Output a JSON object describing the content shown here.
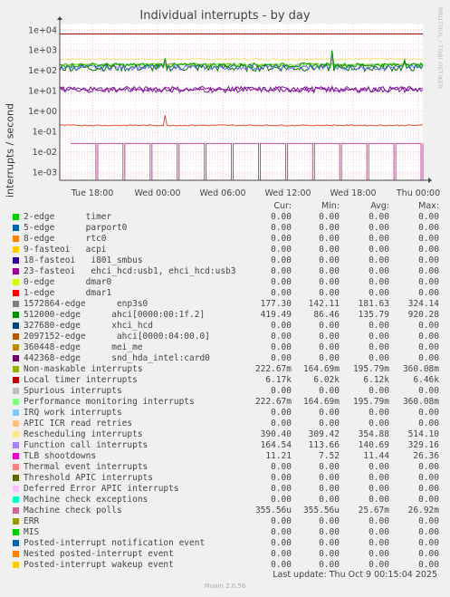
{
  "chart_data": {
    "type": "line",
    "title": "Individual interrupts - by day",
    "ylabel": "interrupts / second",
    "yscale": "log",
    "ylim": [
      0.0004,
      20000
    ],
    "yticks": [
      "1e-03",
      "1e-02",
      "1e-01",
      "1e+00",
      "1e+01",
      "1e+02",
      "1e+03",
      "1e+04"
    ],
    "xticks": [
      "Tue 18:00",
      "Wed 00:00",
      "Wed 06:00",
      "Wed 12:00",
      "Wed 18:00",
      "Thu 00:00"
    ],
    "watermark": "RRDTOOL / TOBI OETIKER",
    "series_visible": [
      {
        "name": "Local timer interrupts",
        "color": "#990000",
        "level": 6170
      },
      {
        "name": "Non-maskable interrupts",
        "color": "#8fa000",
        "level": 195.79
      },
      {
        "name": "Performance monitoring interrupts",
        "color": "#98e878",
        "level": 195.79
      },
      {
        "name": "Machine check polls",
        "color": "#c24a9b",
        "level": 0.0257
      },
      {
        "name": "1572864-edge enp3s0",
        "color": "#00a000",
        "level": 181.63
      },
      {
        "name": "512000-edge ahci[0000:00:1f.2]",
        "color": "#007000",
        "level": 135.79
      },
      {
        "name": "23-fasteoi ehci_hcd:usb1, ehci_hcd:usb3",
        "color": "#990099",
        "level": 12.1
      },
      {
        "name": "Rescheduling interrupts",
        "color": "#f8e070",
        "level": 354.88
      },
      {
        "name": "Function call interrupts",
        "color": "#6a6aff",
        "level": 140.69
      },
      {
        "name": "TLB shootdowns",
        "color": "#6f249f",
        "level": 11.44
      },
      {
        "name": "Thermal event interrupts",
        "color": "#e05030",
        "level": 0.2
      }
    ]
  },
  "legend": {
    "headers": {
      "cur": "Cur:",
      "min": "Min:",
      "avg": "Avg:",
      "max": "Max:"
    },
    "rows": [
      {
        "name": "2-edge      timer",
        "color": "#00cc00",
        "cur": "0.00",
        "min": "0.00",
        "avg": "0.00",
        "max": "0.00"
      },
      {
        "name": "5-edge      parport0",
        "color": "#0066b3",
        "cur": "0.00",
        "min": "0.00",
        "avg": "0.00",
        "max": "0.00"
      },
      {
        "name": "8-edge      rtc0",
        "color": "#ff8000",
        "cur": "0.00",
        "min": "0.00",
        "avg": "0.00",
        "max": "0.00"
      },
      {
        "name": "9-fasteoi   acpi",
        "color": "#ffcc00",
        "cur": "0.00",
        "min": "0.00",
        "avg": "0.00",
        "max": "0.00"
      },
      {
        "name": "18-fasteoi   i801_smbus",
        "color": "#330099",
        "cur": "0.00",
        "min": "0.00",
        "avg": "0.00",
        "max": "0.00"
      },
      {
        "name": "23-fasteoi   ehci_hcd:usb1, ehci_hcd:usb3",
        "color": "#990099",
        "cur": "0.00",
        "min": "0.00",
        "avg": "0.00",
        "max": "0.00"
      },
      {
        "name": "0-edge      dmar0",
        "color": "#ccff00",
        "cur": "0.00",
        "min": "0.00",
        "avg": "0.00",
        "max": "0.00"
      },
      {
        "name": "1-edge      dmar1",
        "color": "#ff0000",
        "cur": "0.00",
        "min": "0.00",
        "avg": "0.00",
        "max": "0.00"
      },
      {
        "name": "1572864-edge      enp3s0",
        "color": "#808080",
        "cur": "177.30",
        "min": "142.11",
        "avg": "181.63",
        "max": "324.14"
      },
      {
        "name": "512000-edge      ahci[0000:00:1f.2]",
        "color": "#008f00",
        "cur": "419.49",
        "min": "86.46",
        "avg": "135.79",
        "max": "920.28"
      },
      {
        "name": "327680-edge      xhci_hcd",
        "color": "#00487d",
        "cur": "0.00",
        "min": "0.00",
        "avg": "0.00",
        "max": "0.00"
      },
      {
        "name": "2097152-edge      ahci[0000:04:00.0]",
        "color": "#b35a00",
        "cur": "0.00",
        "min": "0.00",
        "avg": "0.00",
        "max": "0.00"
      },
      {
        "name": "360448-edge      mei_me",
        "color": "#b38f00",
        "cur": "0.00",
        "min": "0.00",
        "avg": "0.00",
        "max": "0.00"
      },
      {
        "name": "442368-edge      snd_hda_intel:card0",
        "color": "#6b006b",
        "cur": "0.00",
        "min": "0.00",
        "avg": "0.00",
        "max": "0.00"
      },
      {
        "name": "Non-maskable interrupts",
        "color": "#8fb300",
        "cur": "222.67m",
        "min": "164.69m",
        "avg": "195.79m",
        "max": "360.08m"
      },
      {
        "name": "Local timer interrupts",
        "color": "#b30000",
        "cur": "6.17k",
        "min": "6.02k",
        "avg": "6.12k",
        "max": "6.46k"
      },
      {
        "name": "Spurious interrupts",
        "color": "#bebebe",
        "cur": "0.00",
        "min": "0.00",
        "avg": "0.00",
        "max": "0.00"
      },
      {
        "name": "Performance monitoring interrupts",
        "color": "#80ff80",
        "cur": "222.67m",
        "min": "164.69m",
        "avg": "195.79m",
        "max": "360.08m"
      },
      {
        "name": "IRQ work interrupts",
        "color": "#80c9ff",
        "cur": "0.00",
        "min": "0.00",
        "avg": "0.00",
        "max": "0.00"
      },
      {
        "name": "APIC ICR read retries",
        "color": "#ffc080",
        "cur": "0.00",
        "min": "0.00",
        "avg": "0.00",
        "max": "0.00"
      },
      {
        "name": "Rescheduling interrupts",
        "color": "#ffe680",
        "cur": "390.40",
        "min": "309.42",
        "avg": "354.88",
        "max": "514.10"
      },
      {
        "name": "Function call interrupts",
        "color": "#aa80ff",
        "cur": "164.54",
        "min": "113.66",
        "avg": "140.69",
        "max": "329.16"
      },
      {
        "name": "TLB shootdowns",
        "color": "#ee00cc",
        "cur": "11.21",
        "min": "7.52",
        "avg": "11.44",
        "max": "26.36"
      },
      {
        "name": "Thermal event interrupts",
        "color": "#ff8080",
        "cur": "0.00",
        "min": "0.00",
        "avg": "0.00",
        "max": "0.00"
      },
      {
        "name": "Threshold APIC interrupts",
        "color": "#666600",
        "cur": "0.00",
        "min": "0.00",
        "avg": "0.00",
        "max": "0.00"
      },
      {
        "name": "Deferred Error APIC interrupts",
        "color": "#ffbfff",
        "cur": "0.00",
        "min": "0.00",
        "avg": "0.00",
        "max": "0.00"
      },
      {
        "name": "Machine check exceptions",
        "color": "#00ffcc",
        "cur": "0.00",
        "min": "0.00",
        "avg": "0.00",
        "max": "0.00"
      },
      {
        "name": "Machine check polls",
        "color": "#cc6699",
        "cur": "355.56u",
        "min": "355.56u",
        "avg": "25.67m",
        "max": "26.92m"
      },
      {
        "name": "ERR",
        "color": "#999900",
        "cur": "0.00",
        "min": "0.00",
        "avg": "0.00",
        "max": "0.00"
      },
      {
        "name": "MIS",
        "color": "#00cc00",
        "cur": "0.00",
        "min": "0.00",
        "avg": "0.00",
        "max": "0.00"
      },
      {
        "name": "Posted-interrupt notification event",
        "color": "#0066b3",
        "cur": "0.00",
        "min": "0.00",
        "avg": "0.00",
        "max": "0.00"
      },
      {
        "name": "Nested posted-interrupt event",
        "color": "#ff8000",
        "cur": "0.00",
        "min": "0.00",
        "avg": "0.00",
        "max": "0.00"
      },
      {
        "name": "Posted-interrupt wakeup event",
        "color": "#ffcc00",
        "cur": "0.00",
        "min": "0.00",
        "avg": "0.00",
        "max": "0.00"
      }
    ]
  },
  "footer": {
    "last_update": "Last update:  Thu Oct  9 00:15:04 2025",
    "version": "Munin 2.0.56"
  }
}
